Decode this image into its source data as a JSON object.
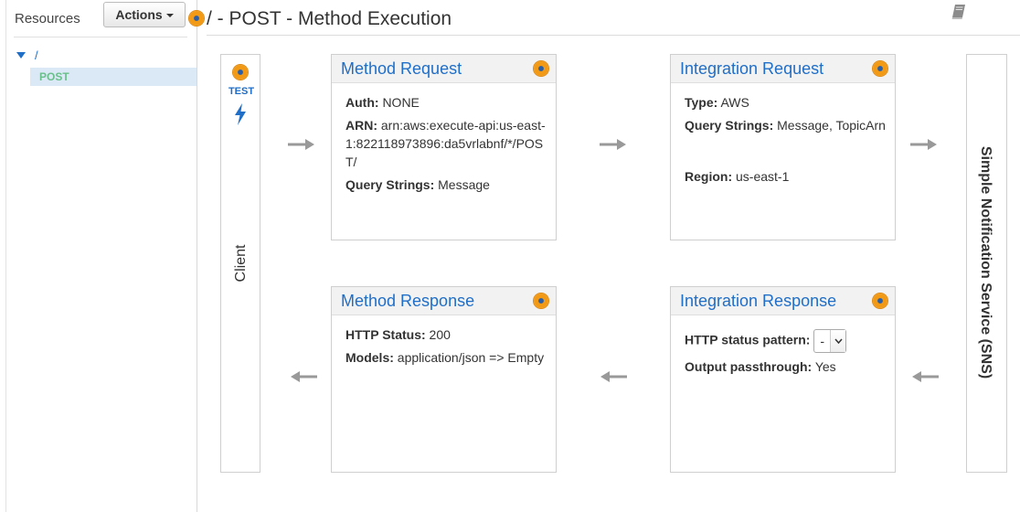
{
  "sidebar": {
    "title": "Resources",
    "actions_label": "Actions",
    "tree": {
      "root_label": "/",
      "selected_method": "POST"
    }
  },
  "header": {
    "title": "/ - POST - Method Execution"
  },
  "client": {
    "test_label": "TEST",
    "label": "Client"
  },
  "service": {
    "label": "Simple Notification Service (SNS)"
  },
  "method_request": {
    "title": "Method Request",
    "auth_label": "Auth:",
    "auth_value": "NONE",
    "arn_label": "ARN:",
    "arn_value": "arn:aws:execute-api:us-east-1:822118973896:da5vrlabnf/*/POST/",
    "query_label": "Query Strings:",
    "query_value": "Message"
  },
  "integration_request": {
    "title": "Integration Request",
    "type_label": "Type:",
    "type_value": "AWS",
    "query_label": "Query Strings:",
    "query_value": "Message, TopicArn",
    "region_label": "Region:",
    "region_value": "us-east-1"
  },
  "method_response": {
    "title": "Method Response",
    "status_label": "HTTP Status:",
    "status_value": "200",
    "models_label": "Models:",
    "models_value": "application/json => Empty"
  },
  "integration_response": {
    "title": "Integration Response",
    "pattern_label": "HTTP status pattern:",
    "pattern_value": "-",
    "passthrough_label": "Output passthrough:",
    "passthrough_value": "Yes"
  },
  "colors": {
    "link_blue": "#1f6ec7",
    "selected_bg": "#dbe9f7",
    "post_green": "#69c08a",
    "help_orange": "#f29a16"
  }
}
